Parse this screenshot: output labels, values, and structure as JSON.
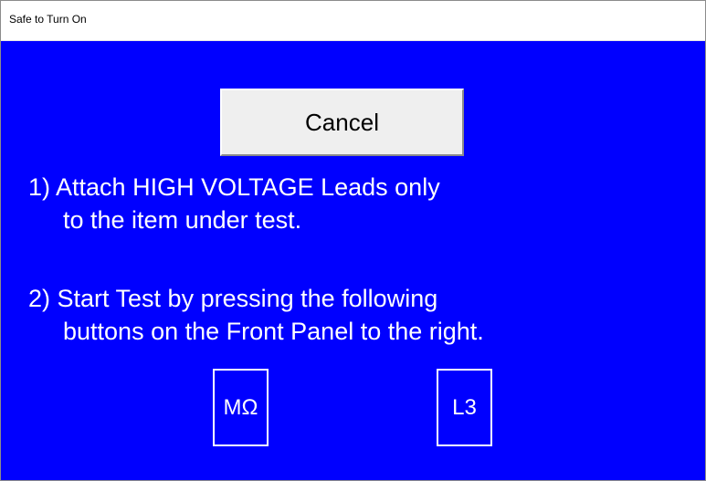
{
  "window": {
    "title": "Safe to Turn On"
  },
  "dialog": {
    "cancel_label": "Cancel",
    "instructions": [
      "1) Attach HIGH VOLTAGE Leads only",
      "to the item under test.",
      "2) Start Test by pressing the following",
      "buttons on the Front Panel to the right."
    ],
    "panel_buttons": [
      {
        "label": "MΩ"
      },
      {
        "label": "L3"
      }
    ]
  },
  "colors": {
    "background": "#0000ff",
    "text": "#ffffff",
    "button_face": "#efefef"
  }
}
